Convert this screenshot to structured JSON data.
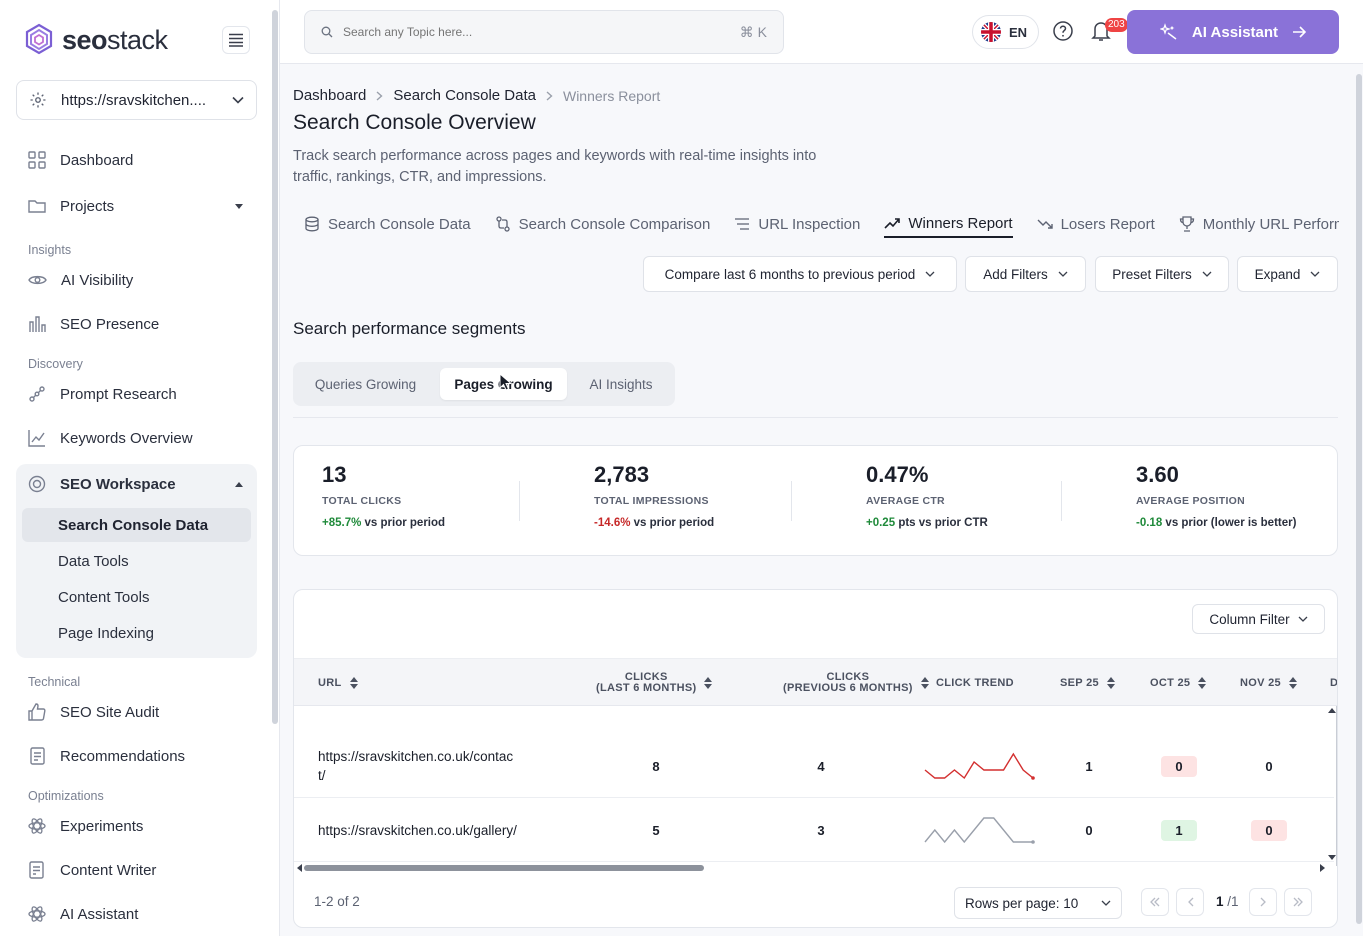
{
  "app": {
    "brand_bold": "seo",
    "brand_light": "stack",
    "accent": "#8a72d8"
  },
  "sidebar": {
    "site": "https://sravskitchen....",
    "items": {
      "dashboard": "Dashboard",
      "projects": "Projects",
      "ai_visibility": "AI Visibility",
      "seo_presence": "SEO Presence",
      "prompt_research": "Prompt Research",
      "keywords_overview": "Keywords Overview",
      "seo_workspace": "SEO Workspace",
      "seo_site_audit": "SEO Site Audit",
      "recommendations": "Recommendations",
      "experiments": "Experiments",
      "content_writer": "Content Writer",
      "ai_assistant": "AI Assistant"
    },
    "sections": {
      "insights": "Insights",
      "discovery": "Discovery",
      "technical": "Technical",
      "optimizations": "Optimizations"
    },
    "workspace_sub": [
      "Search Console Data",
      "Data Tools",
      "Content Tools",
      "Page Indexing"
    ]
  },
  "topbar": {
    "search_placeholder": "Search any Topic here...",
    "shortcut": "⌘ K",
    "lang": "EN",
    "notifications": "203",
    "ai_button": "AI Assistant"
  },
  "breadcrumb": [
    "Dashboard",
    "Search Console Data",
    "Winners Report"
  ],
  "page": {
    "title": "Search Console Overview",
    "description": "Track search performance across pages and keywords with real-time insights into traffic, rankings, CTR, and impressions."
  },
  "tabs": [
    "Search Console Data",
    "Search Console Comparison",
    "URL Inspection",
    "Winners Report",
    "Losers Report",
    "Monthly URL Perform"
  ],
  "filters": {
    "compare": "Compare last 6 months to previous period",
    "add": "Add Filters",
    "preset": "Preset Filters",
    "expand": "Expand"
  },
  "segments": {
    "title": "Search performance segments",
    "tabs": [
      "Queries Growing",
      "Pages Growing",
      "AI Insights"
    ]
  },
  "stats": [
    {
      "value": "13",
      "label": "TOTAL CLICKS",
      "delta": "+85.7%",
      "suffix": "vs prior period"
    },
    {
      "value": "2,783",
      "label": "TOTAL IMPRESSIONS",
      "delta": "-14.6%",
      "suffix": "vs prior period"
    },
    {
      "value": "0.47%",
      "label": "AVERAGE CTR",
      "delta": "+0.25",
      "suffix": "pts vs prior CTR"
    },
    {
      "value": "3.60",
      "label": "AVERAGE POSITION",
      "delta": "-0.18",
      "suffix": "vs prior (lower is better)"
    }
  ],
  "table": {
    "column_filter": "Column Filter",
    "headers": {
      "url": "URL",
      "clicks_last_1": "CLICKS",
      "clicks_last_2": "(LAST 6 MONTHS)",
      "clicks_prev_1": "CLICKS",
      "clicks_prev_2": "(PREVIOUS 6 MONTHS)",
      "trend": "CLICK TREND",
      "sep": "SEP 25",
      "oct": "OCT 25",
      "nov": "NOV 25",
      "dec": "D"
    },
    "rows": [
      {
        "url": "https://sravskitchen.co.uk/contact/",
        "clicks_last": "8",
        "clicks_prev": "4",
        "sep": "1",
        "oct": "0",
        "nov": "0",
        "trend": [
          1,
          0,
          0,
          1,
          0,
          2,
          1,
          1,
          1,
          3,
          1,
          0
        ]
      },
      {
        "url": "https://sravskitchen.co.uk/gallery/",
        "clicks_last": "5",
        "clicks_prev": "3",
        "sep": "0",
        "oct": "1",
        "nov": "0",
        "trend": [
          0,
          1,
          0,
          1,
          0,
          1,
          2,
          2,
          1,
          0,
          0,
          0
        ]
      }
    ]
  },
  "pagination": {
    "count": "1-2 of 2",
    "rows_per_page": "Rows per page: 10",
    "current": "1",
    "total": "/1"
  }
}
